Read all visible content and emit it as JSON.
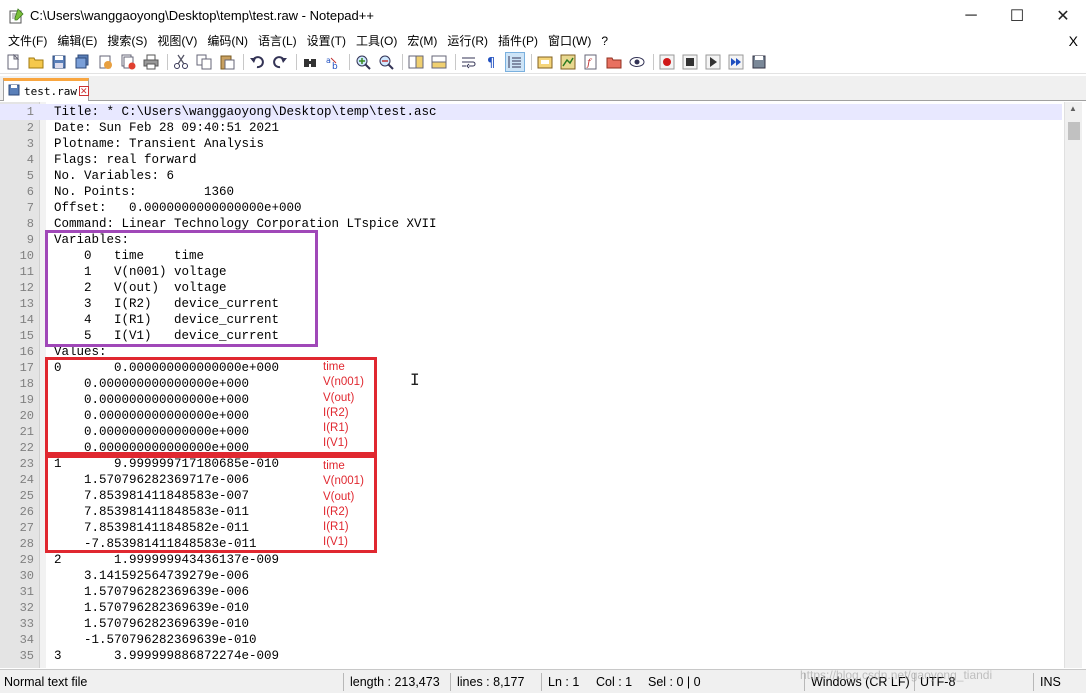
{
  "window": {
    "title": "C:\\Users\\wanggaoyong\\Desktop\\temp\\test.raw - Notepad++",
    "minimize": "─",
    "maximize": "☐",
    "close": "✕"
  },
  "menu": {
    "items": [
      "文件(F)",
      "编辑(E)",
      "搜索(S)",
      "视图(V)",
      "编码(N)",
      "语言(L)",
      "设置(T)",
      "工具(O)",
      "宏(M)",
      "运行(R)",
      "插件(P)",
      "窗口(W)",
      "?"
    ],
    "close_doc": "X"
  },
  "toolbar": {
    "icons": [
      "new-file-icon",
      "open-file-icon",
      "save-icon",
      "save-all-icon",
      "close-icon",
      "close-all-icon",
      "print-icon",
      "cut-icon",
      "copy-icon",
      "paste-icon",
      "undo-icon",
      "redo-icon",
      "find-icon",
      "replace-icon",
      "zoom-in-icon",
      "zoom-out-icon",
      "sync-vertical-icon",
      "sync-horizontal-icon",
      "word-wrap-icon",
      "show-all-chars-icon",
      "indent-guide-icon",
      "user-lang-icon",
      "doc-map-icon",
      "function-list-icon",
      "folder-workspace-icon",
      "monitoring-icon",
      "record-macro-icon",
      "stop-macro-icon",
      "play-macro-icon",
      "run-macro-multiple-icon",
      "save-macro-icon"
    ]
  },
  "tab": {
    "label": "test.raw"
  },
  "editor": {
    "current_line": 1,
    "lines": [
      "Title: * C:\\Users\\wanggaoyong\\Desktop\\temp\\test.asc",
      "Date: Sun Feb 28 09:40:51 2021",
      "Plotname: Transient Analysis",
      "Flags: real forward",
      "No. Variables: 6",
      "No. Points:         1360",
      "Offset:   0.0000000000000000e+000",
      "Command: Linear Technology Corporation LTspice XVII",
      "Variables:",
      "    0   time    time",
      "    1   V(n001) voltage",
      "    2   V(out)  voltage",
      "    3   I(R2)   device_current",
      "    4   I(R1)   device_current",
      "    5   I(V1)   device_current",
      "Values:",
      "0       0.000000000000000e+000",
      "    0.000000000000000e+000",
      "    0.000000000000000e+000",
      "    0.000000000000000e+000",
      "    0.000000000000000e+000",
      "    0.000000000000000e+000",
      "1       9.999999717180685e-010",
      "    1.570796282369717e-006",
      "    7.853981411848583e-007",
      "    7.853981411848583e-011",
      "    7.853981411848582e-011",
      "    -7.853981411848583e-011",
      "2       1.999999943436137e-009",
      "    3.141592564739279e-006",
      "    1.570796282369639e-006",
      "    1.570796282369639e-010",
      "    1.570796282369639e-010",
      "    -1.570796282369639e-010",
      "3       3.999999886872274e-009"
    ]
  },
  "annotations": {
    "group1": [
      "time",
      "V(n001)",
      "V(out)",
      "I(R2)",
      "I(R1)",
      "I(V1)"
    ],
    "group2": [
      "time",
      "V(n001)",
      "V(out)",
      "I(R2)",
      "I(R1)",
      "I(V1)"
    ]
  },
  "statusbar": {
    "file_type": "Normal text file",
    "length": "length : 213,473",
    "lines": "lines : 8,177",
    "ln": "Ln : 1",
    "col": "Col : 1",
    "sel": "Sel : 0 | 0",
    "eol": "Windows (CR LF)",
    "encoding": "UTF-8",
    "mode": "INS"
  },
  "watermark": "https://blog.csdn.net/gaoyong_tiandi",
  "colors": {
    "purple_box": "#a048b8",
    "red_box": "#e02830",
    "tab_accent": "#f9a640"
  }
}
